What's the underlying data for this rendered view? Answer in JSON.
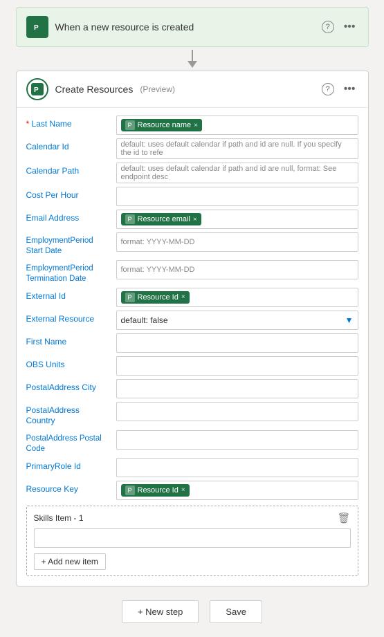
{
  "trigger": {
    "title": "When a new resource is created",
    "icon_label": "P"
  },
  "action": {
    "title": "Create Resources",
    "preview": "(Preview)"
  },
  "fields": [
    {
      "id": "last-name",
      "label": "Last Name",
      "required": true,
      "type": "token",
      "tokens": [
        {
          "label": "Resource name",
          "icon": "P"
        }
      ],
      "placeholder": ""
    },
    {
      "id": "calendar-id",
      "label": "Calendar Id",
      "required": false,
      "type": "placeholder",
      "placeholder": "default: uses default calendar if path and id are null. If you specify the id to refe"
    },
    {
      "id": "calendar-path",
      "label": "Calendar Path",
      "required": false,
      "type": "placeholder",
      "placeholder": "default: uses default calendar if path and id are null, format: See endpoint desc"
    },
    {
      "id": "cost-per-hour",
      "label": "Cost Per Hour",
      "required": false,
      "type": "empty",
      "placeholder": ""
    },
    {
      "id": "email-address",
      "label": "Email Address",
      "required": false,
      "type": "token",
      "tokens": [
        {
          "label": "Resource email",
          "icon": "P"
        }
      ],
      "placeholder": ""
    },
    {
      "id": "employment-start",
      "label": "EmploymentPeriod Start Date",
      "required": false,
      "type": "placeholder",
      "placeholder": "format: YYYY-MM-DD"
    },
    {
      "id": "employment-end",
      "label": "EmploymentPeriod Termination Date",
      "required": false,
      "type": "placeholder",
      "placeholder": "format: YYYY-MM-DD"
    },
    {
      "id": "external-id",
      "label": "External Id",
      "required": false,
      "type": "token",
      "tokens": [
        {
          "label": "Resource Id",
          "icon": "P"
        }
      ],
      "placeholder": ""
    },
    {
      "id": "external-resource",
      "label": "External Resource",
      "required": false,
      "type": "select",
      "value": "default: false"
    },
    {
      "id": "first-name",
      "label": "First Name",
      "required": false,
      "type": "empty",
      "placeholder": ""
    },
    {
      "id": "obs-units",
      "label": "OBS Units",
      "required": false,
      "type": "empty",
      "placeholder": ""
    },
    {
      "id": "postal-city",
      "label": "PostalAddress City",
      "required": false,
      "type": "empty",
      "placeholder": ""
    },
    {
      "id": "postal-country",
      "label": "PostalAddress Country",
      "required": false,
      "type": "empty",
      "placeholder": ""
    },
    {
      "id": "postal-code",
      "label": "PostalAddress Postal Code",
      "required": false,
      "type": "empty",
      "placeholder": ""
    },
    {
      "id": "primary-role",
      "label": "PrimaryRole Id",
      "required": false,
      "type": "empty",
      "placeholder": ""
    },
    {
      "id": "resource-key",
      "label": "Resource Key",
      "required": false,
      "type": "token",
      "tokens": [
        {
          "label": "Resource Id",
          "icon": "P"
        }
      ],
      "placeholder": ""
    }
  ],
  "skills": {
    "item_label": "Skills Item - 1",
    "add_label": "+ Add new item"
  },
  "buttons": {
    "new_step": "+ New step",
    "save": "Save"
  }
}
